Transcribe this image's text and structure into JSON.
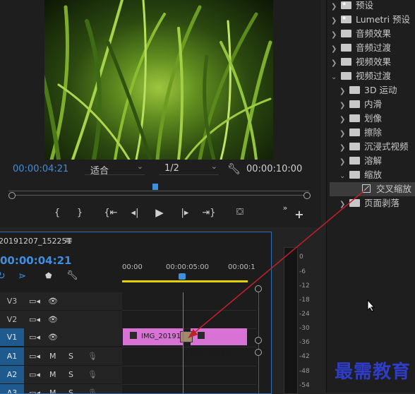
{
  "monitor": {
    "current_timecode": "00:00:04:21",
    "fit_label": "适合",
    "resolution_label": "1/2",
    "duration_timecode": "00:00:10:00",
    "icons": [
      "mark-in-icon",
      "mark-out-icon",
      "go-to-in-icon",
      "step-back-icon",
      "play-icon",
      "step-forward-icon",
      "go-to-out-icon",
      "export-frame-icon",
      "more-icon",
      "add-icon"
    ]
  },
  "effects_panel": {
    "items": [
      {
        "label": "预设",
        "level": 0,
        "expanded": false,
        "starred": true
      },
      {
        "label": "Lumetri 预设",
        "level": 0,
        "expanded": false,
        "starred": true
      },
      {
        "label": "音频效果",
        "level": 0,
        "expanded": false
      },
      {
        "label": "音频过渡",
        "level": 0,
        "expanded": false
      },
      {
        "label": "视频效果",
        "level": 0,
        "expanded": false
      },
      {
        "label": "视频过渡",
        "level": 0,
        "expanded": true
      },
      {
        "label": "3D 运动",
        "level": 1,
        "expanded": false
      },
      {
        "label": "内滑",
        "level": 1,
        "expanded": false
      },
      {
        "label": "划像",
        "level": 1,
        "expanded": false
      },
      {
        "label": "擦除",
        "level": 1,
        "expanded": false
      },
      {
        "label": "沉浸式视频",
        "level": 1,
        "expanded": false
      },
      {
        "label": "溶解",
        "level": 1,
        "expanded": false
      },
      {
        "label": "缩放",
        "level": 1,
        "expanded": true
      },
      {
        "label": "交叉缩放",
        "level": 2,
        "selected": true
      },
      {
        "label": "页面剥落",
        "level": 1,
        "expanded": false
      }
    ]
  },
  "timeline": {
    "sequence_name": "20191207_152251",
    "timecode": "00:00:04:21",
    "ruler": [
      "00:00",
      "00:00:05:00",
      "00:00:1"
    ],
    "tracks": [
      {
        "label": "V3",
        "active": false,
        "kind": "video"
      },
      {
        "label": "V2",
        "active": false,
        "kind": "video"
      },
      {
        "label": "V1",
        "active": true,
        "kind": "video"
      },
      {
        "label": "A1",
        "active": true,
        "kind": "audio",
        "m": "M",
        "s": "S"
      },
      {
        "label": "A2",
        "active": true,
        "kind": "audio",
        "m": "M",
        "s": "S"
      },
      {
        "label": "A3",
        "active": true,
        "kind": "audio",
        "m": "M",
        "s": "S"
      }
    ],
    "clips": [
      {
        "label": "IMG_20191",
        "track": "V1"
      },
      {
        "label": "IMG_20191",
        "track": "V1"
      }
    ]
  },
  "meters": {
    "ticks": [
      "0",
      "-6",
      "-12",
      "-18",
      "-24",
      "-30",
      "-36",
      "-42",
      "-48",
      "-54"
    ]
  },
  "watermark": "最需教育",
  "colors": {
    "accent_blue": "#3f8fe0",
    "clip_pink": "#d873d5",
    "arrow_red": "#c0202a",
    "watermark_blue": "#2f3cc8"
  }
}
